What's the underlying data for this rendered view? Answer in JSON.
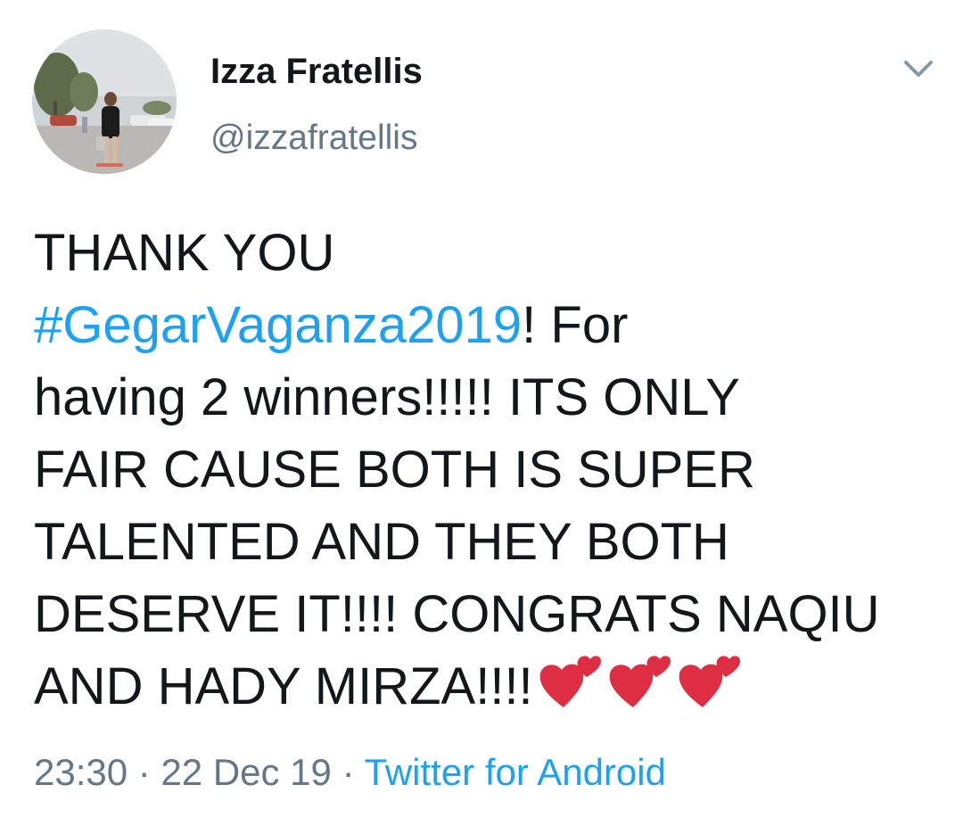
{
  "user": {
    "display_name": "Izza Fratellis",
    "handle": "@izzafratellis"
  },
  "tweet": {
    "line1": "THANK YOU",
    "hashtag": "#GegarVaganza2019",
    "after_hashtag": "! For",
    "line3": "having 2 winners!!!!! ITS ONLY",
    "line4": "FAIR CAUSE BOTH IS SUPER",
    "line5": "TALENTED AND THEY BOTH",
    "line6": "DESERVE IT!!!! CONGRATS NAQIU",
    "line7": "AND HADY MIRZA!!!!",
    "emoji": [
      "two-hearts-icon",
      "two-hearts-icon",
      "two-hearts-icon"
    ]
  },
  "meta": {
    "time": "23:30",
    "separator": " · ",
    "date": "22 Dec 19",
    "source": "Twitter for Android"
  },
  "colors": {
    "link": "#1da1f2",
    "secondary": "#657786",
    "text": "#14171a",
    "heart": "#dd2e44"
  }
}
